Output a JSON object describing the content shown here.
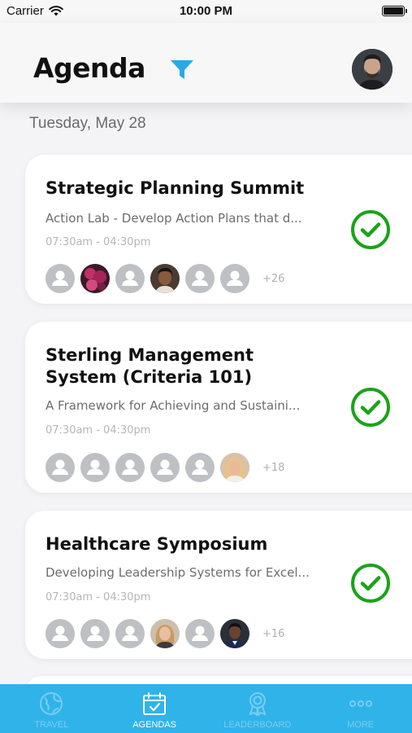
{
  "status_bar": {
    "carrier": "Carrier",
    "time": "10:00 PM"
  },
  "header": {
    "title": "Agenda",
    "filter_icon": "filter-icon",
    "avatar": "user-avatar"
  },
  "date_label": "Tuesday, May 28",
  "colors": {
    "accent": "#30b3e9",
    "check": "#1aa31a",
    "placeholder_avatar": "#bfc0c4"
  },
  "sessions": [
    {
      "title": "Strategic Planning Summit",
      "description": "Action Lab - Develop Action Plans that d...",
      "time": "07:30am - 04:30pm",
      "more_attendees": "+26",
      "status_icon": "check-circle-icon"
    },
    {
      "title": "Sterling Management System (Criteria 101)",
      "description": "A Framework for Achieving and Sustaini...",
      "time": "07:30am - 04:30pm",
      "more_attendees": "+18",
      "status_icon": "check-circle-icon"
    },
    {
      "title": "Healthcare Symposium",
      "description": "Developing Leadership Systems for Excel...",
      "time": "07:30am - 04:30pm",
      "more_attendees": "+16",
      "status_icon": "check-circle-icon"
    }
  ],
  "tabs": [
    {
      "label": "TRAVEL",
      "icon": "globe-icon",
      "active": false
    },
    {
      "label": "AGENDAS",
      "icon": "calendar-check-icon",
      "active": true
    },
    {
      "label": "LEADERBOARD",
      "icon": "award-icon",
      "active": false
    },
    {
      "label": "MORE",
      "icon": "more-dots-icon",
      "active": false
    }
  ]
}
